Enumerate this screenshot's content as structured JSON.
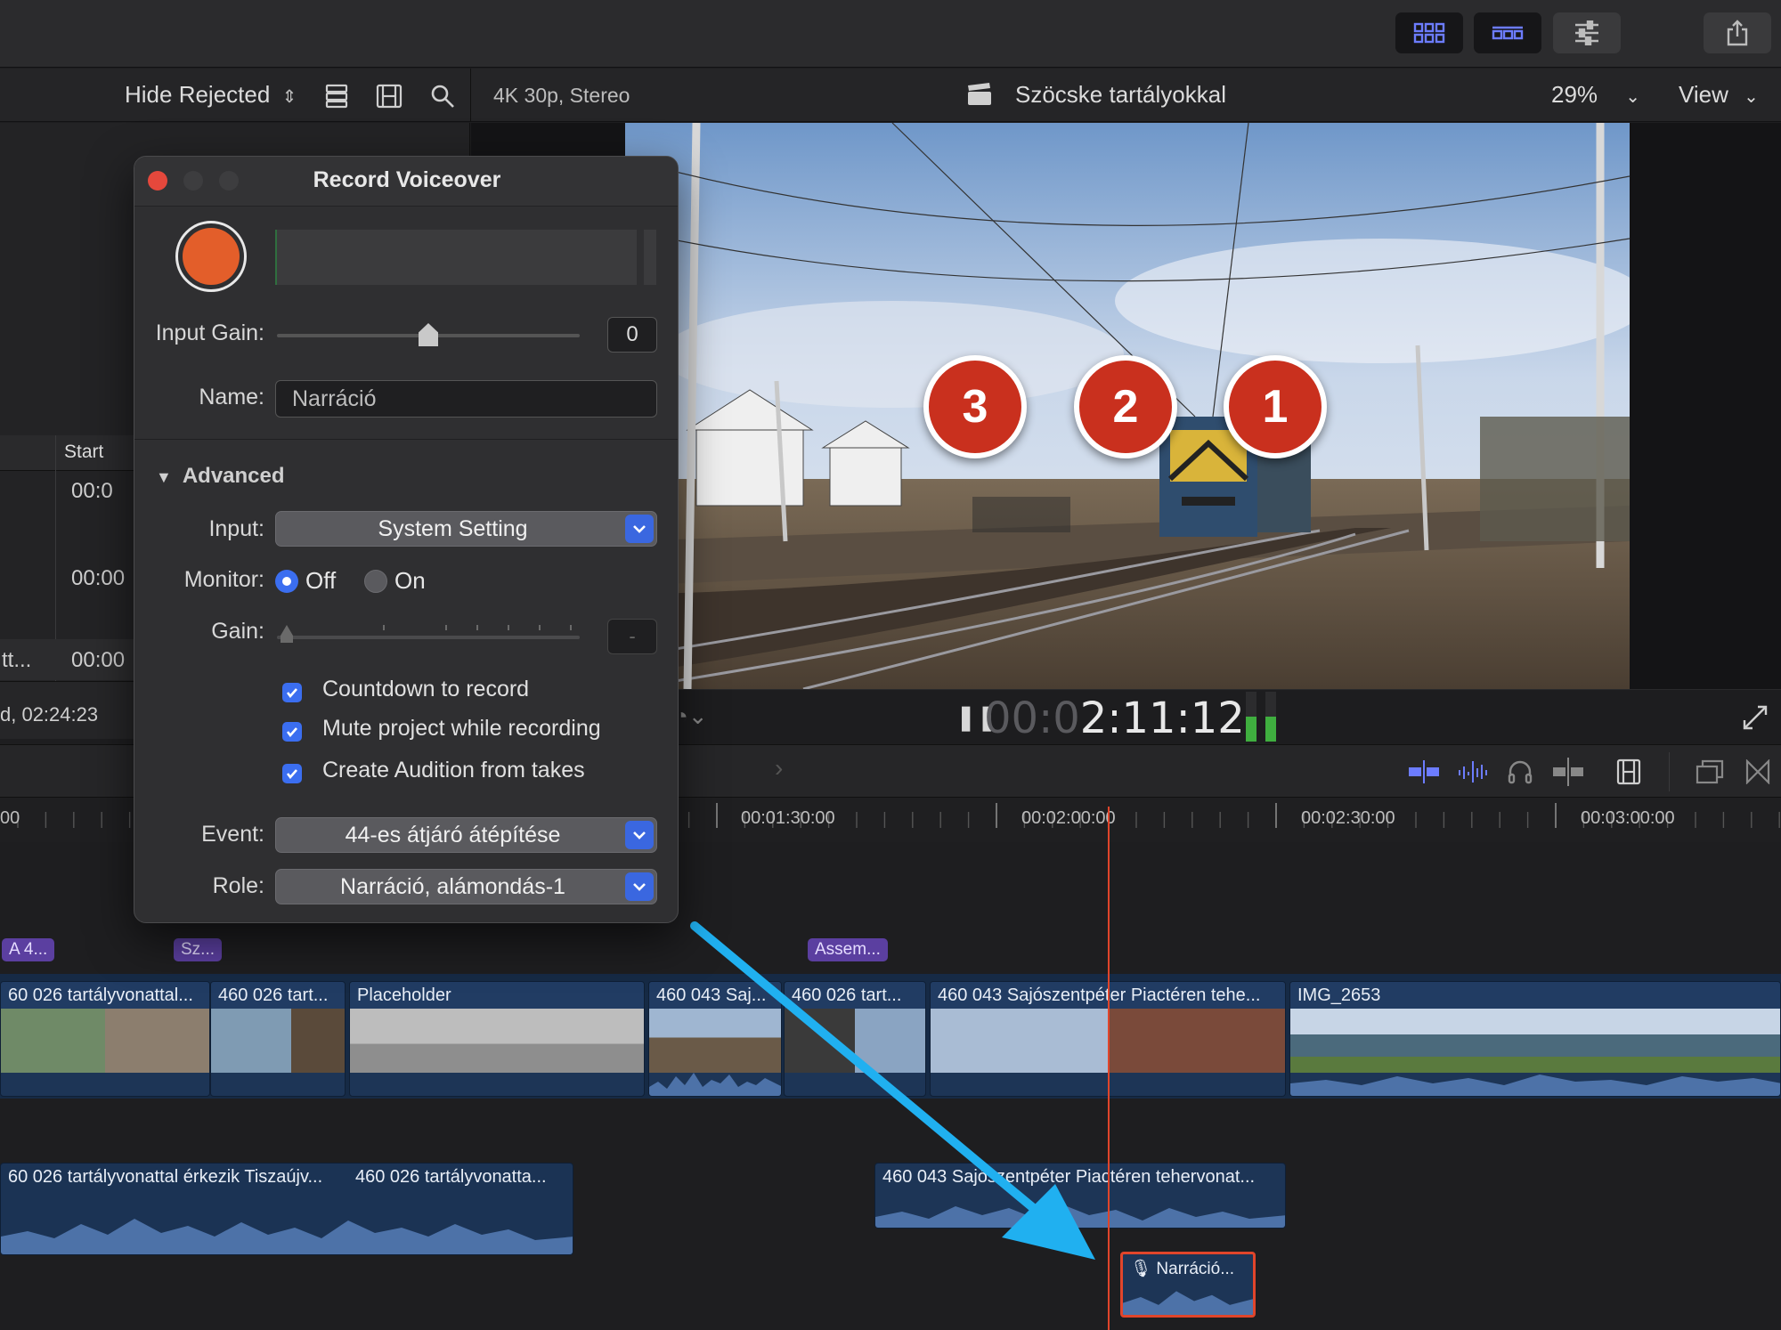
{
  "colors": {
    "accent": "#3b6ef0",
    "record": "#e35e2a",
    "badge": "#c9301e",
    "arrow": "#20b0f0",
    "playhead": "#e0452b",
    "clip": "#1d3556",
    "marker": "#5b3fa0"
  },
  "toolbar": {
    "buttons": [
      {
        "name": "grid-view-icon",
        "active": true
      },
      {
        "name": "filmstrip-view-icon",
        "active": true
      },
      {
        "name": "inspector-sliders-icon",
        "active": false
      },
      {
        "name": "share-icon",
        "active": false
      }
    ]
  },
  "browser_bar": {
    "filter": "Hide Rejected",
    "icons": [
      "clip-appearance-icon",
      "filmstrip-icon",
      "search-icon"
    ]
  },
  "browser_list": {
    "column_start": "Start",
    "rows": [
      "00:0",
      "00:00",
      "00:00"
    ],
    "left_partial": "tt...",
    "duration": "d, 02:24:23"
  },
  "viewer": {
    "format": "4K 30p, Stereo",
    "project_title": "Szöcske tartályokkal",
    "zoom": "29%",
    "view_menu": "View",
    "timecode_dim": "00:0",
    "timecode_bright": "2:11:12",
    "badges": [
      "3",
      "2",
      "1"
    ]
  },
  "timeline": {
    "ruler_ticks": [
      "00",
      "00:01:30:00",
      "00:02:00:00",
      "00:02:30:00",
      "00:03:00:00"
    ],
    "markers": [
      "A 4...",
      "Sz...",
      "Assem..."
    ],
    "primary_clips": [
      "60 026 tartályvonattal...",
      "460 026 tart...",
      "Placeholder",
      "460 043 Saj...",
      "460 026 tart...",
      "460 043 Sajószentpéter Piactéren tehe...",
      "IMG_2653"
    ],
    "audio_clips": [
      "60 026 tartályvonattal érkezik Tiszaújv...",
      "460 026 tartályvonatta...",
      "460 043 Sajószentpéter Piactéren tehervonat...",
      "Narráció..."
    ]
  },
  "dialog": {
    "title": "Record Voiceover",
    "input_gain_label": "Input Gain:",
    "input_gain_value": "0",
    "input_gain_level": 0.5,
    "name_label": "Name:",
    "name_value": "Narráció",
    "advanced_label": "Advanced",
    "input_label": "Input:",
    "input_value": "System Setting",
    "monitor_label": "Monitor:",
    "monitor_off": "Off",
    "monitor_on": "On",
    "monitor_selected": "Off",
    "gain_label": "Gain:",
    "gain_value": "-",
    "checkboxes": [
      {
        "label": "Countdown to record",
        "checked": true
      },
      {
        "label": "Mute project while recording",
        "checked": true
      },
      {
        "label": "Create Audition from takes",
        "checked": true
      }
    ],
    "event_label": "Event:",
    "event_value": "44-es átjáró átépítése",
    "role_label": "Role:",
    "role_value": "Narráció, alámondás-1"
  }
}
